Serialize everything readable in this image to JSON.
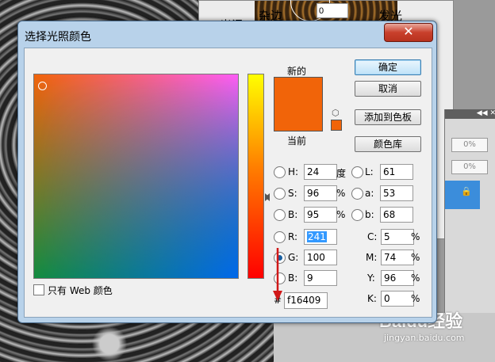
{
  "background": {
    "panel_labels": [
      "杂边",
      "发光",
      "光泽"
    ],
    "panel_value": "0",
    "layers": {
      "opacity_1": "0%",
      "opacity_2": "0%",
      "toolbar_icons": "◀◀ ✕"
    },
    "watermark": {
      "brand": "Baidu经验",
      "url": "jingyan.baidu.com"
    }
  },
  "dialog": {
    "title": "选择光照颜色",
    "close_label": "✕",
    "label_new": "新的",
    "label_current": "当前",
    "current_color": "#f16409",
    "buttons": {
      "ok": "确定",
      "cancel": "取消",
      "add_swatch": "添加到色板",
      "color_library": "颜色库"
    },
    "hsb": {
      "h": {
        "label": "H:",
        "value": "24",
        "unit": "度"
      },
      "s": {
        "label": "S:",
        "value": "96",
        "unit": "%"
      },
      "b": {
        "label": "B:",
        "value": "95",
        "unit": "%"
      }
    },
    "lab": {
      "l": {
        "label": "L:",
        "value": "61"
      },
      "a": {
        "label": "a:",
        "value": "53"
      },
      "b": {
        "label": "b:",
        "value": "68"
      }
    },
    "rgb": {
      "r": {
        "label": "R:",
        "value": "241"
      },
      "g": {
        "label": "G:",
        "value": "100"
      },
      "b": {
        "label": "B:",
        "value": "9"
      }
    },
    "cmyk": {
      "c": {
        "label": "C:",
        "value": "5",
        "unit": "%"
      },
      "m": {
        "label": "M:",
        "value": "74",
        "unit": "%"
      },
      "y": {
        "label": "Y:",
        "value": "96",
        "unit": "%"
      },
      "k": {
        "label": "K:",
        "value": "0",
        "unit": "%"
      }
    },
    "web_only_label": "只有 Web 颜色",
    "hex_symbol": "#",
    "hex_value": "f16409",
    "selected_channel": "G"
  }
}
